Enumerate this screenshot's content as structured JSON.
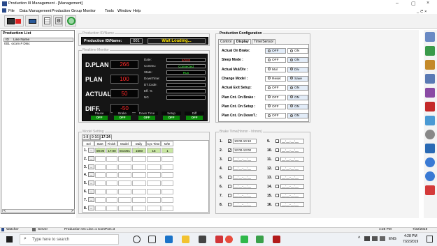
{
  "window": {
    "title": "Production III Management - [Management]",
    "min": "–",
    "max": "▢",
    "close": "×",
    "inner_controls": "_ ㄹ ×"
  },
  "menu": [
    "File",
    "Data Management",
    "Production Group Monitor",
    "Tools",
    "Window",
    "Help"
  ],
  "production_list": {
    "title": "Production List",
    "cols": [
      "ID",
      "Line Name"
    ],
    "rows": [
      {
        "id": "001",
        "name": "ocom # Disc"
      }
    ],
    "scroll_left": "<",
    "scroll_right": ">"
  },
  "prod_id": {
    "legend": "Production ID/Name",
    "label": "Production ID/Name:",
    "id": "001",
    "status": "Wait Loading..."
  },
  "realtime": {
    "legend": "Realtime Monitor",
    "dplan_label": "D.PLAN",
    "dplan": "266",
    "plan_label": "PLAN",
    "plan": "100",
    "actual_label": "ACTUAL",
    "actual": "50",
    "diff_label": "DIFF.",
    "diff": "-50",
    "info": [
      {
        "label": "Date:",
        "value": "5/5/80",
        "color": "#ff3333"
      },
      {
        "label": "Commu:",
        "value": "Connected",
        "color": "#33ff33"
      },
      {
        "label": "State:",
        "value": "Run",
        "color": "#33ff33"
      },
      {
        "label": "DownTime:",
        "value": "",
        "color": "#fff"
      },
      {
        "label": "DT.Code:",
        "value": "",
        "color": "#fff"
      },
      {
        "label": "Eff. %",
        "value": "",
        "color": "#fff"
      },
      {
        "label": "NG",
        "value": "",
        "color": "#fff"
      }
    ],
    "states": [
      {
        "label": "Pause",
        "value": "OFF"
      },
      {
        "label": "Brake",
        "value": "OFF"
      },
      {
        "label": "Down Time",
        "value": "OFF"
      },
      {
        "label": "Setup",
        "value": "OFF"
      },
      {
        "label": "Diff",
        "value": "OFF"
      }
    ]
  },
  "config": {
    "legend": "Production Configuration",
    "tabs": [
      "Control",
      "Display",
      "Time/Sensor"
    ],
    "rows": [
      {
        "label": "Actual On Brake:",
        "a": "OFF",
        "b": "ON",
        "sel": "a"
      },
      {
        "label": "Sleep Mode :",
        "a": "OFF",
        "b": "ON",
        "sel": "b"
      },
      {
        "label": "Actual Mul/Div :",
        "a": "Mul",
        "b": "Div",
        "sel": "b"
      },
      {
        "label": "Change Model :",
        "a": "Reset",
        "b": "Save",
        "sel": "b"
      },
      {
        "label": "Actual Exit Setup:",
        "a": "OFF",
        "b": "ON",
        "sel": "b"
      },
      {
        "label": "Plan Cnt. On Brake :",
        "a": "OFF",
        "b": "ON",
        "sel": "b"
      },
      {
        "label": "Plan Cnt. On Setup :",
        "a": "OFF",
        "b": "ON",
        "sel": "b"
      },
      {
        "label": "Plan Cnt. On DownT.:",
        "a": "OFF",
        "b": "ON",
        "sel": "b"
      }
    ]
  },
  "model": {
    "legend": "Model Setting",
    "tabs": [
      "1-8",
      "9-16",
      "17-24"
    ],
    "cols": [
      "Sel",
      "Start Time",
      "Finish Time",
      "Model Name",
      "Daily Plan",
      "Cyc Time",
      "M/D"
    ],
    "rows": [
      {
        "n": "1.",
        "btn": "...",
        "start": "08:00",
        "finish": "17:00",
        "model": "ECO01",
        "daily": "1500",
        "cyc": "15",
        "md": "1"
      },
      {
        "n": "2.",
        "btn": "...",
        "start": "",
        "finish": "",
        "model": "",
        "daily": "",
        "cyc": "",
        "md": ""
      },
      {
        "n": "3.",
        "btn": "...",
        "start": "",
        "finish": "",
        "model": "",
        "daily": "",
        "cyc": "",
        "md": ""
      },
      {
        "n": "4.",
        "btn": "...",
        "start": "",
        "finish": "",
        "model": "",
        "daily": "",
        "cyc": "",
        "md": ""
      },
      {
        "n": "5.",
        "btn": "...",
        "start": "",
        "finish": "",
        "model": "",
        "daily": "",
        "cyc": "",
        "md": ""
      },
      {
        "n": "6.",
        "btn": "...",
        "start": "",
        "finish": "",
        "model": "",
        "daily": "",
        "cyc": "",
        "md": ""
      },
      {
        "n": "7.",
        "btn": "...",
        "start": "",
        "finish": "",
        "model": "",
        "daily": "",
        "cyc": "",
        "md": ""
      },
      {
        "n": "8.",
        "btn": "...",
        "start": "",
        "finish": "",
        "model": "",
        "daily": "",
        "cyc": "",
        "md": ""
      }
    ]
  },
  "brake": {
    "legend": "Brake Time(hhmm - hhmm)",
    "left": [
      {
        "n": "1.",
        "checked": true,
        "v": "10:00-10:10"
      },
      {
        "n": "2.",
        "checked": true,
        "v": "12:00-13:00"
      },
      {
        "n": "3.",
        "checked": false,
        "v": "__:__-__:__"
      },
      {
        "n": "4.",
        "checked": false,
        "v": "__:__-__:__"
      },
      {
        "n": "5.",
        "checked": false,
        "v": "__:__-__:__"
      },
      {
        "n": "6.",
        "checked": false,
        "v": "__:__-__:__"
      },
      {
        "n": "7.",
        "checked": false,
        "v": "__:__-__:__"
      },
      {
        "n": "8.",
        "checked": false,
        "v": "__:__-__:__"
      }
    ],
    "right": [
      {
        "n": "9.",
        "checked": false,
        "v": "__:__-__:__"
      },
      {
        "n": "10.",
        "checked": false,
        "v": "__:__-__:__"
      },
      {
        "n": "11.",
        "checked": false,
        "v": "__:__-__:__"
      },
      {
        "n": "12.",
        "checked": false,
        "v": "__:__-__:__"
      },
      {
        "n": "13.",
        "checked": false,
        "v": "__:__-__:__"
      },
      {
        "n": "14.",
        "checked": false,
        "v": "__:__-__:__"
      },
      {
        "n": "15.",
        "checked": false,
        "v": "__:__-__:__"
      },
      {
        "n": "16.",
        "checked": false,
        "v": "__:__-__:__"
      }
    ]
  },
  "status": {
    "watcher": "Watcher",
    "server": "Server",
    "online": "Production On Line=1 ComPort=3",
    "time": "4:28 PM",
    "date": "7/22/2019"
  },
  "taskbar": {
    "search": "Type here to search",
    "lang": "ENG",
    "time": "4:28 PM",
    "date": "7/22/2019"
  },
  "colors": {
    "green": "#0a8a0a",
    "red": "#ff2a2a",
    "cell_green": "#c7e6a0"
  }
}
